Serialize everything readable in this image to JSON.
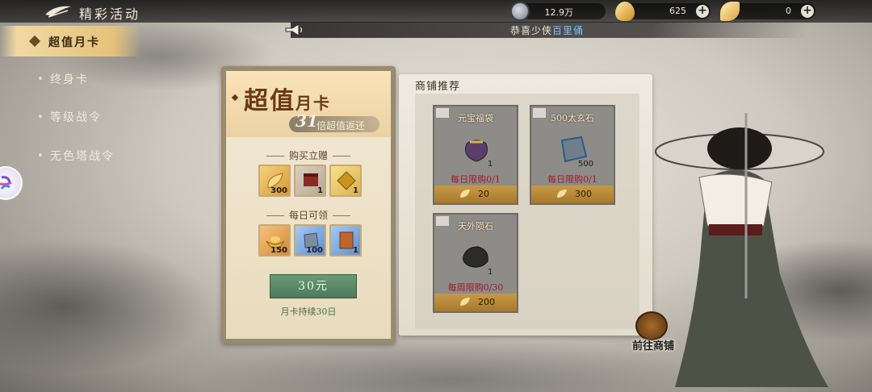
{
  "header": {
    "title": "精彩活动",
    "resources": [
      {
        "icon": "silver-coin-icon",
        "value": "12.9万"
      },
      {
        "icon": "gold-ingot-icon",
        "value": "625"
      },
      {
        "icon": "gold-leaf-icon",
        "value": "0"
      }
    ]
  },
  "marquee": {
    "prefix": "恭喜少侠",
    "name": "百里俑"
  },
  "sidebar": {
    "items": [
      {
        "label": "超值月卡",
        "active": true
      },
      {
        "label": "终身卡",
        "active": false
      },
      {
        "label": "等级战令",
        "active": false
      },
      {
        "label": "无色塔战令",
        "active": false
      }
    ]
  },
  "month_card": {
    "title_big": "超值",
    "title_small": "月卡",
    "multiplier": "31",
    "multiplier_text": "倍超值返还",
    "instant_label": "购买立赠",
    "instant_items": [
      {
        "icon": "gold-leaf-icon",
        "count": "300"
      },
      {
        "icon": "red-banner-icon",
        "count": "1"
      },
      {
        "icon": "golden-token-icon",
        "count": "1"
      }
    ],
    "daily_label": "每日可领",
    "daily_items": [
      {
        "icon": "gold-ingot-icon",
        "count": "150"
      },
      {
        "icon": "blue-stone-icon",
        "count": "100"
      },
      {
        "icon": "scroll-icon",
        "count": "1"
      }
    ],
    "price": "30元",
    "duration_prefix": "月卡持续",
    "duration_days": "30日"
  },
  "shop": {
    "title": "商铺推荐",
    "items": [
      {
        "name": "元宝福袋",
        "qty": "1",
        "limit": "每日限购0/1",
        "price": "20",
        "icon": "lucky-bag-icon"
      },
      {
        "name": "500太玄石",
        "qty": "500",
        "limit": "每日限购0/1",
        "price": "300",
        "icon": "blue-stone-icon"
      },
      {
        "name": "天外陨石",
        "qty": "1",
        "limit": "每周限购0/30",
        "price": "200",
        "icon": "meteorite-icon"
      }
    ],
    "go_label": "前往商铺"
  }
}
